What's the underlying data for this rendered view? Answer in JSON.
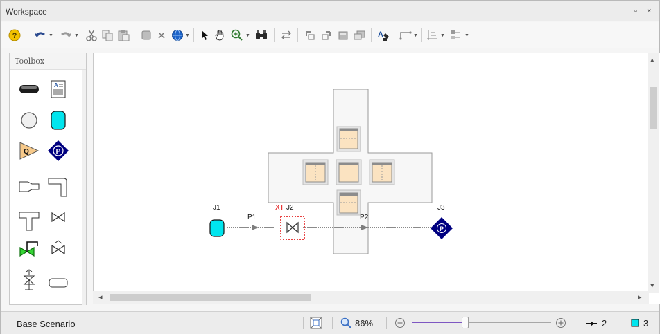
{
  "window": {
    "title": "Workspace",
    "restore_glyph": "▫",
    "close_glyph": "×"
  },
  "toolbar": {
    "buttons": [
      "help-icon",
      "undo-icon",
      "redo-icon",
      "cut-icon",
      "copy-icon",
      "paste-icon",
      "select-all-icon",
      "delete-icon",
      "globe-icon",
      "pointer-icon",
      "pan-hand-icon",
      "zoom-icon",
      "find-icon",
      "reverse-icon",
      "align-left-icon",
      "align-right-icon",
      "lock-icon",
      "group-icon",
      "annotation-icon",
      "pipe-bend-icon",
      "grid-icon",
      "layout-icon"
    ]
  },
  "toolbox": {
    "title": "Toolbox",
    "items": [
      "pipe-tool",
      "annotation-tool",
      "junction-tool",
      "tank-tool",
      "assigned-flow-tool",
      "pump-tool",
      "reducer-tool",
      "bend-tool",
      "tee-tool",
      "valve-tool",
      "control-valve-tool",
      "check-valve-tool",
      "relief-valve-tool",
      "dead-end-tool"
    ]
  },
  "canvas": {
    "junctions": [
      {
        "name": "J1",
        "type": "tank",
        "color": "#00e5ee"
      },
      {
        "name": "J2",
        "prefix": "XT",
        "type": "valve",
        "selected": true
      },
      {
        "name": "J3",
        "type": "pump",
        "color": "#000080",
        "symbol": "P"
      }
    ],
    "pipes": [
      {
        "name": "P1"
      },
      {
        "name": "P2"
      }
    ]
  },
  "status": {
    "scenario": "Base Scenario",
    "zoom": "86%",
    "zoom_slider_level": 0.38,
    "pipe_count": "2",
    "junction_count": "3"
  },
  "colors": {
    "tank": "#00e5ee",
    "pump": "#000080",
    "selection": "#e00000",
    "dock_fill": "#fbe3c1"
  }
}
